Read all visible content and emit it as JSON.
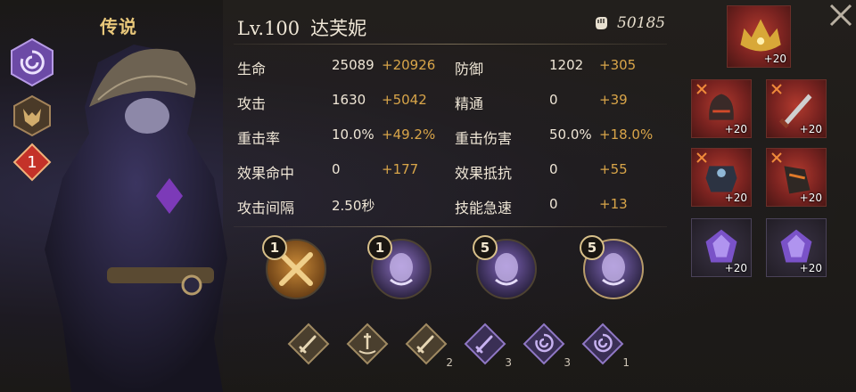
{
  "character": {
    "rarity_label": "传说",
    "level": "Lv.100",
    "name": "达芙妮",
    "power": "50185",
    "side_badge_number": "1"
  },
  "stats": [
    {
      "name": "生命",
      "value": "25089",
      "bonus": "+20926"
    },
    {
      "name": "防御",
      "value": "1202",
      "bonus": "+305"
    },
    {
      "name": "攻击",
      "value": "1630",
      "bonus": "+5042"
    },
    {
      "name": "精通",
      "value": "0",
      "bonus": "+39"
    },
    {
      "name": "重击率",
      "value": "10.0%",
      "bonus": "+49.2%"
    },
    {
      "name": "重击伤害",
      "value": "50.0%",
      "bonus": "+18.0%"
    },
    {
      "name": "效果命中",
      "value": "0",
      "bonus": "+177"
    },
    {
      "name": "效果抵抗",
      "value": "0",
      "bonus": "+55"
    },
    {
      "name": "攻击间隔",
      "value": "2.50秒",
      "bonus": ""
    },
    {
      "name": "技能急速",
      "value": "0",
      "bonus": "+13"
    }
  ],
  "skills": [
    {
      "icon": "crossed-swords-icon",
      "level": "1"
    },
    {
      "icon": "spirit-face-icon",
      "level": "1"
    },
    {
      "icon": "purple-spirit-icon",
      "level": "5"
    },
    {
      "icon": "ornate-spirit-icon",
      "level": "5"
    }
  ],
  "runes": [
    {
      "icon": "sword-icon",
      "count": ""
    },
    {
      "icon": "sword-in-stone-icon",
      "count": ""
    },
    {
      "icon": "sword-icon",
      "count": "2"
    },
    {
      "icon": "purple-sword-icon",
      "count": "3"
    },
    {
      "icon": "vortex-icon",
      "count": "3"
    },
    {
      "icon": "purple-vortex-icon",
      "count": "1"
    }
  ],
  "equipment": [
    {
      "slot": "crown",
      "level": "+20"
    },
    {
      "slot": "helmet",
      "level": "+20"
    },
    {
      "slot": "dagger",
      "level": "+20"
    },
    {
      "slot": "armor",
      "level": "+20"
    },
    {
      "slot": "gauntlets",
      "level": "+20"
    },
    {
      "slot": "gem-1",
      "level": "+20"
    },
    {
      "slot": "gem-2",
      "level": "+20"
    }
  ],
  "colors": {
    "bonus": "#d9a549",
    "gold": "#e8c77a",
    "equip_red": "#b23a2e",
    "purple": "#6a4fb0"
  }
}
